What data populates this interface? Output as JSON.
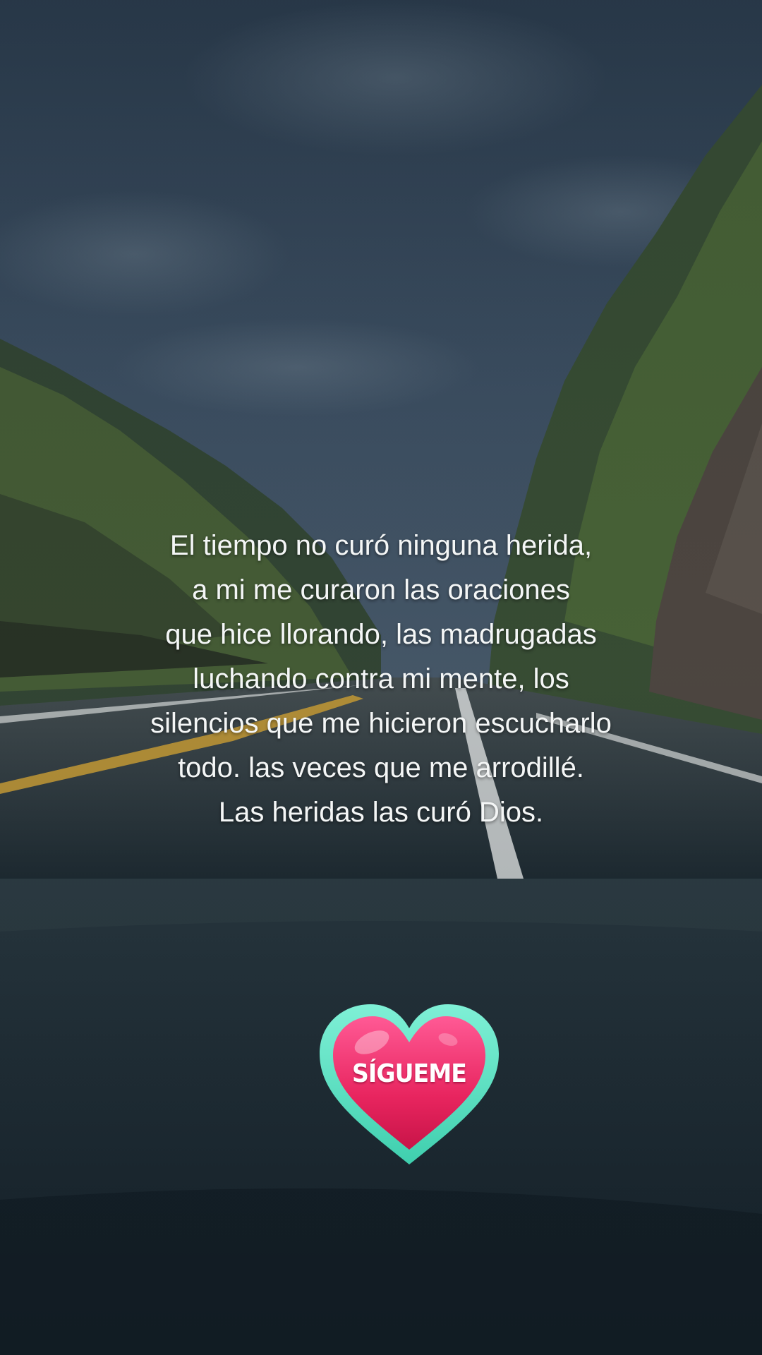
{
  "quote": {
    "lines": [
      "El tiempo no curó ninguna herida,",
      "a mi me curaron las oraciones",
      "que hice llorando, las madrugadas",
      "luchando contra mi mente, los",
      "silencios que me hicieron escucharlo",
      "todo. las veces que me arrodillé.",
      "Las heridas las curó Dios."
    ]
  },
  "follow_sticker": {
    "label": "SÍGUEME",
    "icon": "heart-icon",
    "colors": {
      "heart": "#e8255f",
      "outline": "#5fe3c4"
    }
  },
  "colors": {
    "sky": "#3b4f63",
    "foliage": "#4f6a3a",
    "road": "#3a4549",
    "text": "#f4f6f6"
  }
}
